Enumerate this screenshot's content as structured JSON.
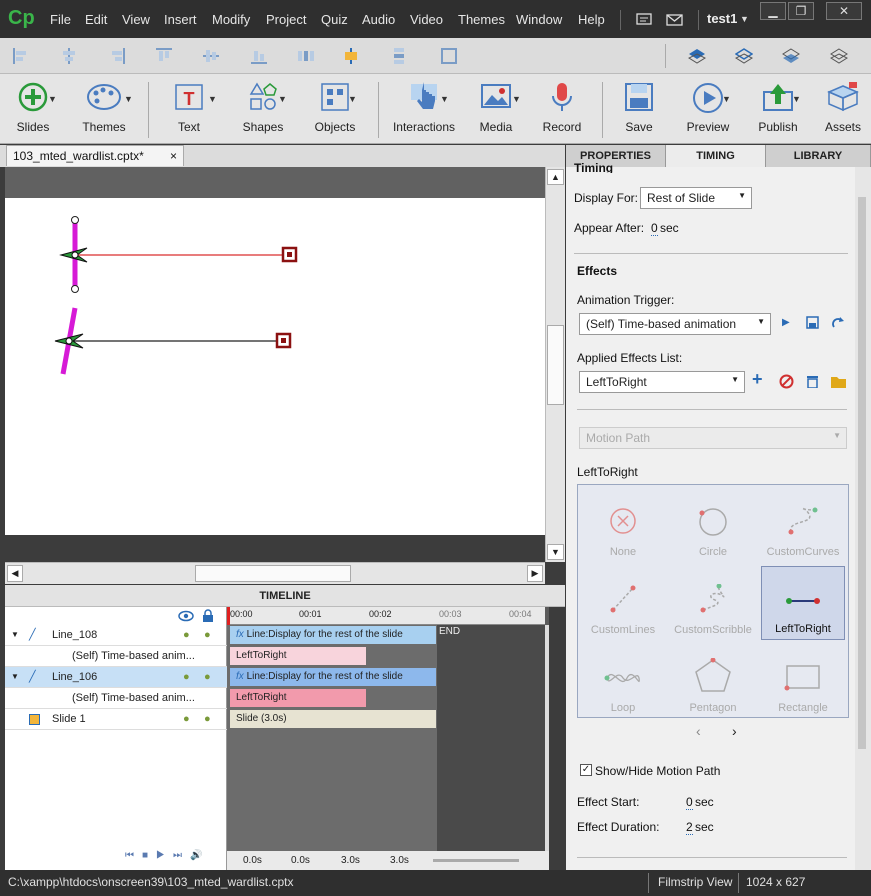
{
  "app": {
    "logo": "Cp",
    "user": "test1"
  },
  "menu": [
    "File",
    "Edit",
    "View",
    "Insert",
    "Modify",
    "Project",
    "Quiz",
    "Audio",
    "Video",
    "Themes",
    "Window",
    "Help"
  ],
  "toolbar": {
    "slides": "Slides",
    "themes": "Themes",
    "text": "Text",
    "shapes": "Shapes",
    "objects": "Objects",
    "interactions": "Interactions",
    "media": "Media",
    "record": "Record",
    "save": "Save",
    "preview": "Preview",
    "publish": "Publish",
    "assets": "Assets"
  },
  "document": {
    "tab": "103_mted_wardlist.cptx*",
    "close": "×"
  },
  "timeline": {
    "title": "TIMELINE",
    "ruler": [
      "00:00",
      "00:01",
      "00:02",
      "00:03",
      "00:04"
    ],
    "rows": [
      {
        "name": "Line_108",
        "bar": "Line:Display for the rest of the slide"
      },
      {
        "name": "(Self) Time-based anim...",
        "bar": "LeftToRight"
      },
      {
        "name": "Line_106",
        "bar": "Line:Display for the rest of the slide"
      },
      {
        "name": "(Self) Time-based anim...",
        "bar": "LeftToRight"
      },
      {
        "name": "Slide 1",
        "bar": "Slide (3.0s)"
      }
    ],
    "end": "END",
    "fx": "fx",
    "footer": {
      "t1": "0.0s",
      "t2": "0.0s",
      "t3": "3.0s",
      "t4": "3.0s"
    }
  },
  "panel": {
    "tabs": [
      "PROPERTIES",
      "TIMING",
      "LIBRARY"
    ],
    "timing_header": "Timing",
    "display_for_label": "Display For:",
    "display_for_value": "Rest of Slide",
    "appear_after_label": "Appear After:",
    "appear_after_value": "0",
    "sec": "sec",
    "effects_header": "Effects",
    "trigger_label": "Animation Trigger:",
    "trigger_value": "(Self) Time-based animation",
    "applied_label": "Applied Effects List:",
    "applied_value": "LeftToRight",
    "motion_path": "Motion Path",
    "effect_name": "LeftToRight",
    "effects": [
      "None",
      "Circle",
      "CustomCurves",
      "CustomLines",
      "CustomScribble",
      "LeftToRight",
      "Loop",
      "Pentagon",
      "Rectangle"
    ],
    "show_hide": "Show/Hide Motion Path",
    "effect_start_label": "Effect Start:",
    "effect_start_value": "0",
    "effect_duration_label": "Effect Duration:",
    "effect_duration_value": "2"
  },
  "status": {
    "path": "C:\\xampp\\htdocs\\onscreen39\\103_mted_wardlist.cptx",
    "view": "Filmstrip View",
    "size": "1024 x 627"
  },
  "colors": {
    "accent": "#3ab54a",
    "stage_magenta": "#d61ad6",
    "path_red": "#e05050",
    "timeline_blue": "#a8d0f0",
    "timeline_pink": "#f4b6c4"
  }
}
